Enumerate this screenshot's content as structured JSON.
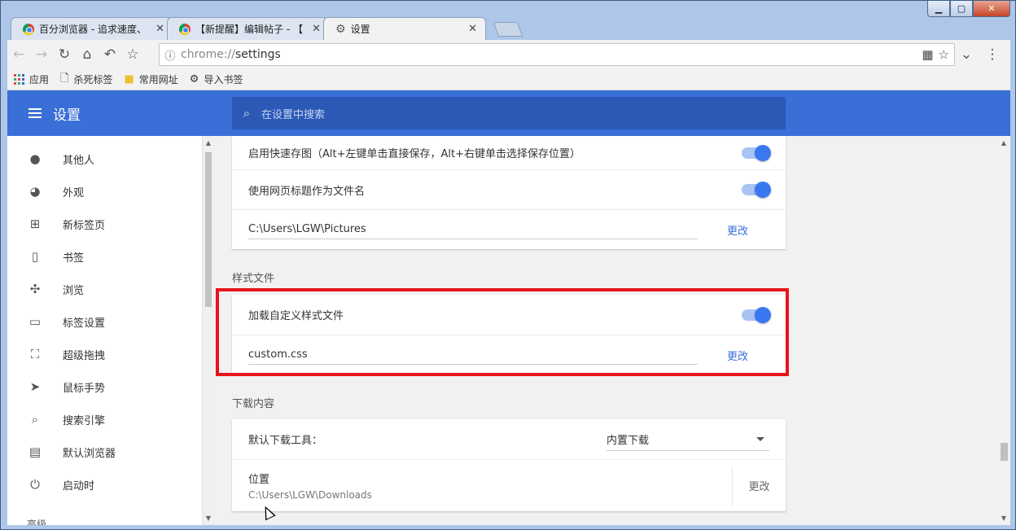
{
  "window": {
    "minimize": "▁",
    "maximize": "▢",
    "close": "✕"
  },
  "tabs": [
    {
      "label": "百分浏览器 - 追求速度、",
      "close": "✕"
    },
    {
      "label": "【新提醒】编辑帖子 - 【",
      "close": "✕"
    },
    {
      "label": "设置",
      "close": "✕"
    }
  ],
  "toolbar": {
    "url_scheme": "chrome://",
    "url_path": "settings"
  },
  "bookmarks": [
    {
      "label": "应用",
      "icon": "apps-icon"
    },
    {
      "label": "杀死标签",
      "icon": "page-icon"
    },
    {
      "label": "常用网址",
      "icon": "folder-icon"
    },
    {
      "label": "导入书签",
      "icon": "gear-icon"
    }
  ],
  "header": {
    "title": "设置",
    "search_placeholder": "在设置中搜索"
  },
  "sidebar": {
    "items": [
      {
        "label": "其他人",
        "icon": "person-icon"
      },
      {
        "label": "外观",
        "icon": "palette-icon"
      },
      {
        "label": "新标签页",
        "icon": "new-tab-icon"
      },
      {
        "label": "书签",
        "icon": "bookmark-icon"
      },
      {
        "label": "浏览",
        "icon": "browse-icon"
      },
      {
        "label": "标签设置",
        "icon": "tab-settings-icon"
      },
      {
        "label": "超级拖拽",
        "icon": "drag-icon"
      },
      {
        "label": "鼠标手势",
        "icon": "pointer-icon"
      },
      {
        "label": "搜索引擎",
        "icon": "search-icon"
      },
      {
        "label": "默认浏览器",
        "icon": "browser-icon"
      },
      {
        "label": "启动时",
        "icon": "power-icon"
      }
    ],
    "advanced": "高级"
  },
  "screenshot_card": {
    "quick_save": "启用快速存图（Alt+左键单击直接保存，Alt+右键单击选择保存位置）",
    "use_title": "使用网页标题作为文件名",
    "path": "C:\\Users\\LGW\\Pictures",
    "change": "更改"
  },
  "style_section": {
    "title": "样式文件",
    "load_custom": "加载自定义样式文件",
    "file": "custom.css",
    "change": "更改"
  },
  "download_section": {
    "title": "下载内容",
    "default_tool_label": "默认下载工具：",
    "default_tool_value": "内置下载",
    "location_label": "位置",
    "location_path": "C:\\Users\\LGW\\Downloads",
    "change": "更改"
  },
  "colors": {
    "header": "#3a6fd8",
    "accent": "#3a78f2",
    "highlight": "#e8141b"
  }
}
